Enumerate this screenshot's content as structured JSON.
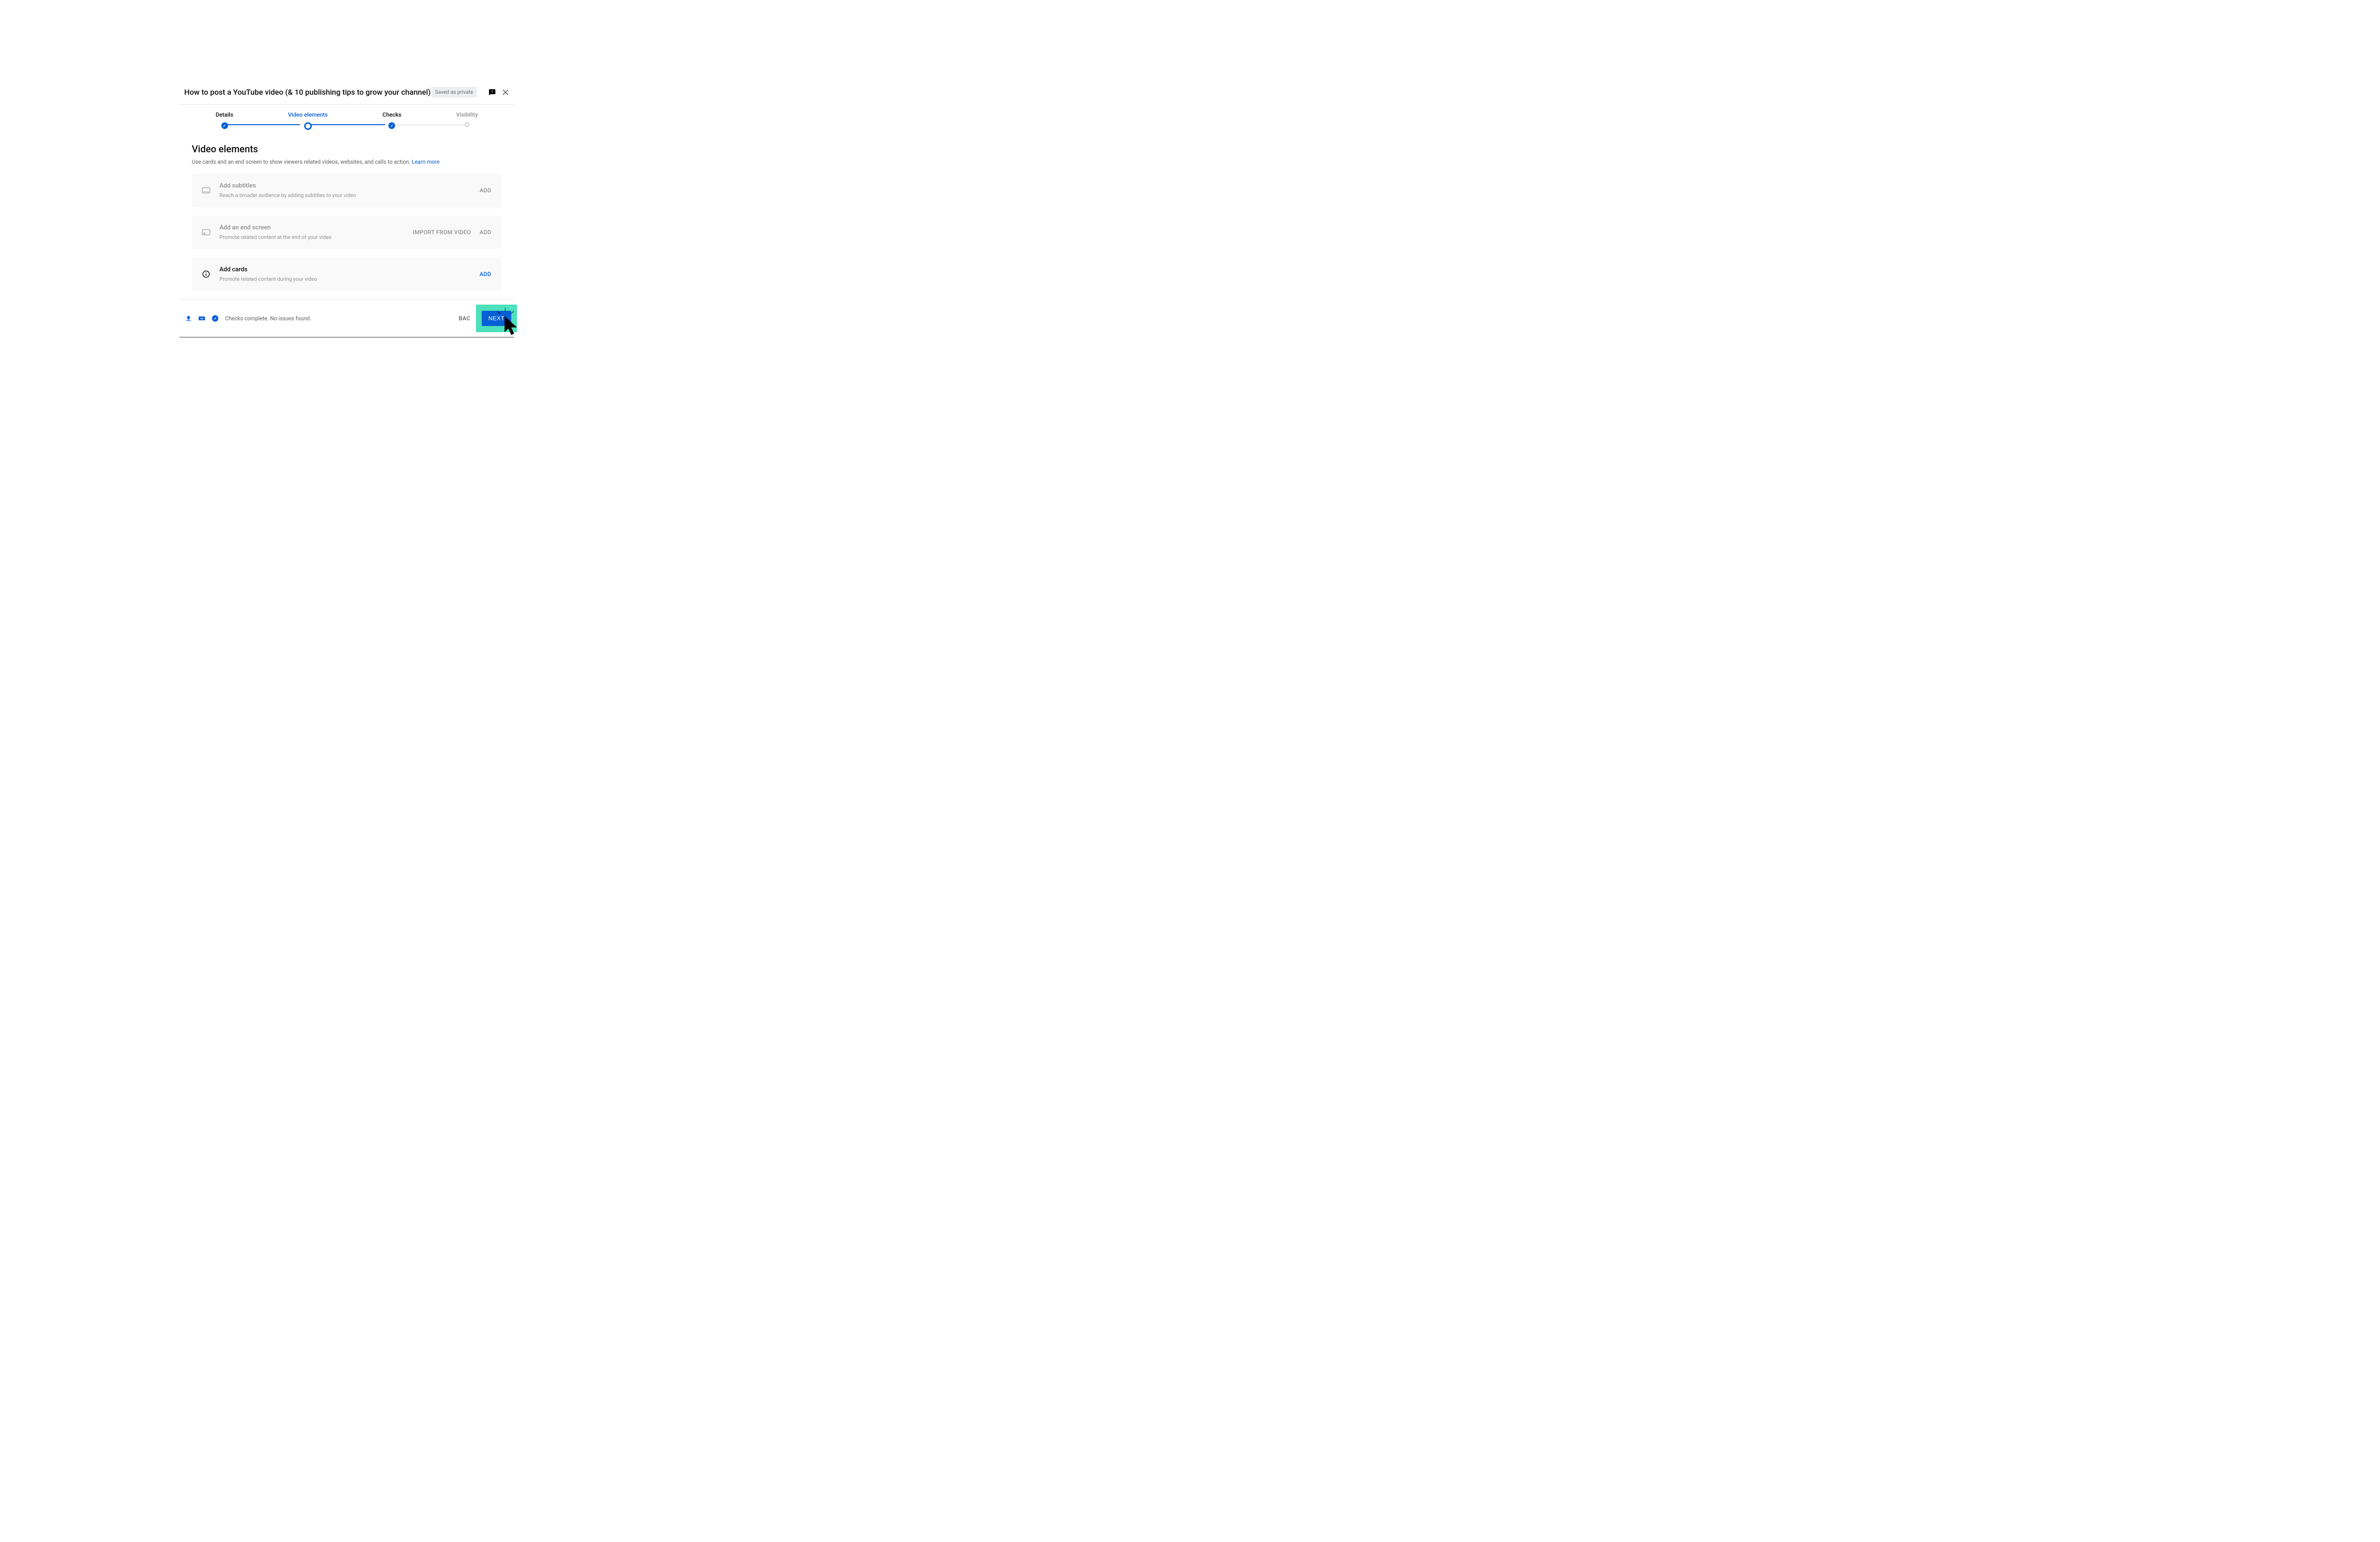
{
  "header": {
    "title": "How to post a YouTube video (& 10 publishing tips to grow your channel)",
    "badge": "Saved as private"
  },
  "stepper": {
    "steps": [
      {
        "label": "Details"
      },
      {
        "label": "Video elements"
      },
      {
        "label": "Checks"
      },
      {
        "label": "Visibility"
      }
    ]
  },
  "section": {
    "title": "Video elements",
    "desc": "Use cards and an end screen to show viewers related videos, websites, and calls to action. ",
    "learn": "Learn more"
  },
  "cards": {
    "subtitles": {
      "title": "Add subtitles",
      "desc": "Reach a broader audience by adding subtitles to your video",
      "add": "ADD"
    },
    "endscreen": {
      "title": "Add an end screen",
      "desc": "Promote related content at the end of your video",
      "import": "IMPORT FROM VIDEO",
      "add": "ADD"
    },
    "addcards": {
      "title": "Add cards",
      "desc": "Promote related content during your video",
      "add": "ADD"
    }
  },
  "footer": {
    "status": "Checks complete. No issues found.",
    "back": "BAC",
    "next": "NEXT"
  }
}
